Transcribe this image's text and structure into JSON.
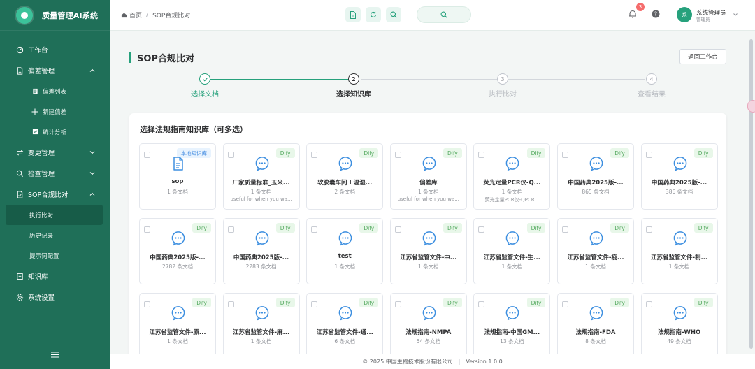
{
  "app": {
    "title": "质量管理AI系统"
  },
  "sidebar": {
    "items": [
      {
        "label": "工作台",
        "icon": "dashboard-icon"
      },
      {
        "label": "偏差管理",
        "icon": "file-icon",
        "expanded": true,
        "children": [
          {
            "label": "偏差列表",
            "icon": "list-icon"
          },
          {
            "label": "新建偏差",
            "icon": "plus-icon"
          },
          {
            "label": "统计分析",
            "icon": "chart-icon"
          }
        ]
      },
      {
        "label": "变更管理",
        "icon": "swap-icon",
        "expanded": false
      },
      {
        "label": "检查管理",
        "icon": "search-icon",
        "expanded": false
      },
      {
        "label": "SOP合规比对",
        "icon": "document-icon",
        "expanded": true,
        "children": [
          {
            "label": "执行比对",
            "active": true
          },
          {
            "label": "历史记录"
          },
          {
            "label": "提示词配置"
          }
        ]
      },
      {
        "label": "知识库",
        "icon": "book-icon"
      },
      {
        "label": "系统设置",
        "icon": "gear-icon"
      }
    ],
    "collapse_icon": "menu-icon"
  },
  "header": {
    "breadcrumb": {
      "home": "首页",
      "current": "SOP合规比对"
    },
    "notification_count": "3",
    "user": {
      "avatar_text": "系",
      "name": "系统管理员",
      "role": "管理员"
    }
  },
  "main": {
    "page_title": "SOP合规比对",
    "back_button": "返回工作台",
    "steps": [
      {
        "number": "1",
        "label": "选择文档",
        "status": "done"
      },
      {
        "number": "2",
        "label": "选择知识库",
        "status": "active"
      },
      {
        "number": "3",
        "label": "执行比对",
        "status": "pending"
      },
      {
        "number": "4",
        "label": "查看结果",
        "status": "pending"
      }
    ],
    "panel_title": "选择法规指南知识库（可多选）",
    "knowledge_bases": [
      {
        "tag": "本地知识库",
        "tag_type": "local",
        "icon": "document-icon",
        "name": "sop",
        "count": "1 条文档",
        "desc": ""
      },
      {
        "tag": "Dify",
        "tag_type": "dify",
        "icon": "chat-icon",
        "name": "厂家质量标准_玉米...",
        "count": "1 条文档",
        "desc": "useful for when you wa..."
      },
      {
        "tag": "Dify",
        "tag_type": "dify",
        "icon": "chat-icon",
        "name": "软胶囊车间 I 温湿...",
        "count": "2 条文档",
        "desc": ""
      },
      {
        "tag": "Dify",
        "tag_type": "dify",
        "icon": "chat-icon",
        "name": "偏差库",
        "count": "1 条文档",
        "desc": "useful for when you wa..."
      },
      {
        "tag": "Dify",
        "tag_type": "dify",
        "icon": "chat-icon",
        "name": "荧光定量PCR仪-Q...",
        "count": "1 条文档",
        "desc": "荧光定量PCR仪-QPCR..."
      },
      {
        "tag": "Dify",
        "tag_type": "dify",
        "icon": "chat-icon",
        "name": "中国药典2025版-...",
        "count": "865 条文档",
        "desc": ""
      },
      {
        "tag": "Dify",
        "tag_type": "dify",
        "icon": "chat-icon",
        "name": "中国药典2025版-...",
        "count": "386 条文档",
        "desc": ""
      },
      {
        "tag": "Dify",
        "tag_type": "dify",
        "icon": "chat-icon",
        "name": "中国药典2025版-...",
        "count": "2782 条文档",
        "desc": ""
      },
      {
        "tag": "Dify",
        "tag_type": "dify",
        "icon": "chat-icon",
        "name": "中国药典2025版-...",
        "count": "2283 条文档",
        "desc": ""
      },
      {
        "tag": "Dify",
        "tag_type": "dify",
        "icon": "chat-icon",
        "name": "test",
        "count": "1 条文档",
        "desc": ""
      },
      {
        "tag": "Dify",
        "tag_type": "dify",
        "icon": "chat-icon",
        "name": "江苏省监管文件-中...",
        "count": "1 条文档",
        "desc": ""
      },
      {
        "tag": "Dify",
        "tag_type": "dify",
        "icon": "chat-icon",
        "name": "江苏省监管文件-生...",
        "count": "1 条文档",
        "desc": ""
      },
      {
        "tag": "Dify",
        "tag_type": "dify",
        "icon": "chat-icon",
        "name": "江苏省监管文件-疫...",
        "count": "1 条文档",
        "desc": ""
      },
      {
        "tag": "Dify",
        "tag_type": "dify",
        "icon": "chat-icon",
        "name": "江苏省监管文件-制...",
        "count": "1 条文档",
        "desc": ""
      },
      {
        "tag": "Dify",
        "tag_type": "dify",
        "icon": "chat-icon",
        "name": "江苏省监管文件-原...",
        "count": "1 条文档",
        "desc": ""
      },
      {
        "tag": "Dify",
        "tag_type": "dify",
        "icon": "chat-icon",
        "name": "江苏省监管文件-麻...",
        "count": "1 条文档",
        "desc": ""
      },
      {
        "tag": "Dify",
        "tag_type": "dify",
        "icon": "chat-icon",
        "name": "江苏省监管文件-通...",
        "count": "6 条文档",
        "desc": ""
      },
      {
        "tag": "Dify",
        "tag_type": "dify",
        "icon": "chat-icon",
        "name": "法规指南-NMPA",
        "count": "54 条文档",
        "desc": ""
      },
      {
        "tag": "Dify",
        "tag_type": "dify",
        "icon": "chat-icon",
        "name": "法规指南-中国GM...",
        "count": "13 条文档",
        "desc": ""
      },
      {
        "tag": "Dify",
        "tag_type": "dify",
        "icon": "chat-icon",
        "name": "法规指南-FDA",
        "count": "8 条文档",
        "desc": ""
      },
      {
        "tag": "Dify",
        "tag_type": "dify",
        "icon": "chat-icon",
        "name": "法规指南-WHO",
        "count": "49 条文档",
        "desc": ""
      }
    ]
  },
  "footer": {
    "copyright": "© 2025 中国生物技术股份有限公司",
    "version": "Version 1.0.0"
  },
  "colors": {
    "sidebar_bg": "#1f6f58",
    "accent": "#26a17c",
    "dify_tag": "#52a85d",
    "local_tag": "#4a90e2"
  }
}
